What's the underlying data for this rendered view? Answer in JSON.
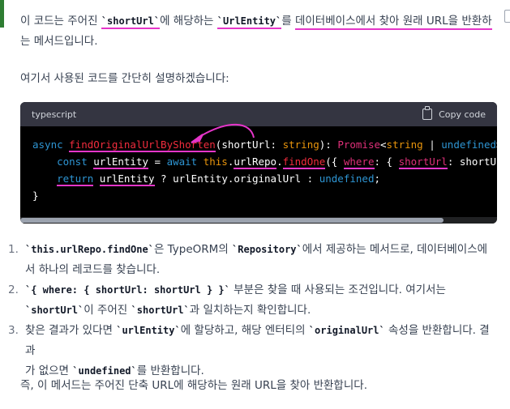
{
  "intro": {
    "p1_pre": "이 코드는 주어진 ",
    "p1_code1": "`shortUrl`",
    "p1_mid": "에 해당하는 ",
    "p1_code2": "`UrlEntity`",
    "p1_mid2": "를 ",
    "p1_mark": "데이터베이스에서 찾아 원래 URL을 반환하",
    "p1_line2": "는 메서드입니다.",
    "p2": "여기서 사용된 코드를 간단히 설명하겠습니다:"
  },
  "codeblock": {
    "language": "typescript",
    "copy_label": "Copy code",
    "line1": {
      "kw": "async ",
      "fn": "findOriginalUrlByShorten",
      "a": "(",
      "param": "shortUrl",
      "b": ": ",
      "ty1": "string",
      "c": "): ",
      "ty2": "Promise",
      "d": "<",
      "ty3": "string",
      "e": " | ",
      "ty4": "undefined",
      "f": "> {"
    },
    "line2": {
      "indent": "    ",
      "kw": "const ",
      "var": "urlEntity",
      "a": " = ",
      "kw2": "await ",
      "this": "this",
      "b": ".",
      "repo": "urlRepo",
      "c": ".",
      "fn": "findOne",
      "d": "({ ",
      "where": "where",
      "e": ": { ",
      "key": "shortUrl",
      "f": ": shortUrl } });"
    },
    "line3": {
      "indent": "    ",
      "kw": "return",
      "a": " ",
      "var": "urlEntity",
      "b": " ? urlEntity.originalUrl : ",
      "undef": "undefined",
      "c": ";"
    },
    "line4": "}"
  },
  "steps": [
    {
      "num": "1.",
      "code1": "`this.urlRepo.findOne`",
      "t1": "은 TypeORM의 ",
      "code2": "`Repository`",
      "t2": "에서 제공하는 메서드로, 데이터베이스에",
      "t3": "서 하나의 레코드를 찾습니다."
    },
    {
      "num": "2.",
      "code1": "`{ where: { shortUrl: shortUrl } }`",
      "t1": " 부분은 찾을 때 사용되는 조건입니다. 여기서는",
      "code2": "`shortUrl`",
      "t2": "이 주어진 ",
      "code3": "`shortUrl`",
      "t3": "과 일치하는지 확인합니다."
    },
    {
      "num": "3.",
      "t0": "찾은 결과가 있다면 ",
      "code1": "`urlEntity`",
      "t1": "에 할당하고, 해당 엔터티의 ",
      "code2": "`originalUrl`",
      "t2": " 속성을 반환합니다. 결과",
      "t3": "가 없으면 ",
      "code3": "`undefined`",
      "t4": "를 반환합니다."
    }
  ],
  "summary": "즉, 이 메서드는 주어진 단축 URL에 해당하는 원래 URL을 찾아 반환합니다.",
  "colors": {
    "highlight": "#e535c9",
    "accent_bar": "#2e7d32"
  }
}
